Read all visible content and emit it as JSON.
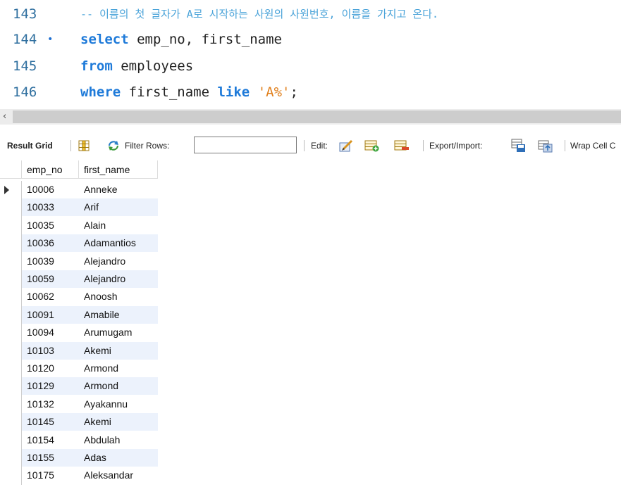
{
  "editor": {
    "lines": [
      {
        "num": "143",
        "comment": "-- 이름의 첫 글자가 A로 시작하는 사원의 사원번호, 이름을 가지고 온다."
      },
      {
        "num": "144",
        "breakpoint": "•",
        "kw1": "select",
        "rest": " emp_no, first_name"
      },
      {
        "num": "145",
        "kw1": "from",
        "rest": " employees"
      },
      {
        "num": "146",
        "kw1": "where",
        "mid": " first_name ",
        "kw2": "like",
        "str": "'A%'",
        "end": ";"
      }
    ]
  },
  "scrollbar": {
    "left_arrow": "‹"
  },
  "toolbar": {
    "result_grid": "Result Grid",
    "filter_rows": "Filter Rows:",
    "filter_value": "",
    "edit": "Edit:",
    "export_import": "Export/Import:",
    "wrap_cell": "Wrap Cell C"
  },
  "grid": {
    "columns": [
      "emp_no",
      "first_name"
    ],
    "rows": [
      [
        "10006",
        "Anneke"
      ],
      [
        "10033",
        "Arif"
      ],
      [
        "10035",
        "Alain"
      ],
      [
        "10036",
        "Adamantios"
      ],
      [
        "10039",
        "Alejandro"
      ],
      [
        "10059",
        "Alejandro"
      ],
      [
        "10062",
        "Anoosh"
      ],
      [
        "10091",
        "Amabile"
      ],
      [
        "10094",
        "Arumugam"
      ],
      [
        "10103",
        "Akemi"
      ],
      [
        "10120",
        "Armond"
      ],
      [
        "10129",
        "Armond"
      ],
      [
        "10132",
        "Ayakannu"
      ],
      [
        "10145",
        "Akemi"
      ],
      [
        "10154",
        "Abdulah"
      ],
      [
        "10155",
        "Adas"
      ],
      [
        "10175",
        "Aleksandar"
      ]
    ]
  }
}
